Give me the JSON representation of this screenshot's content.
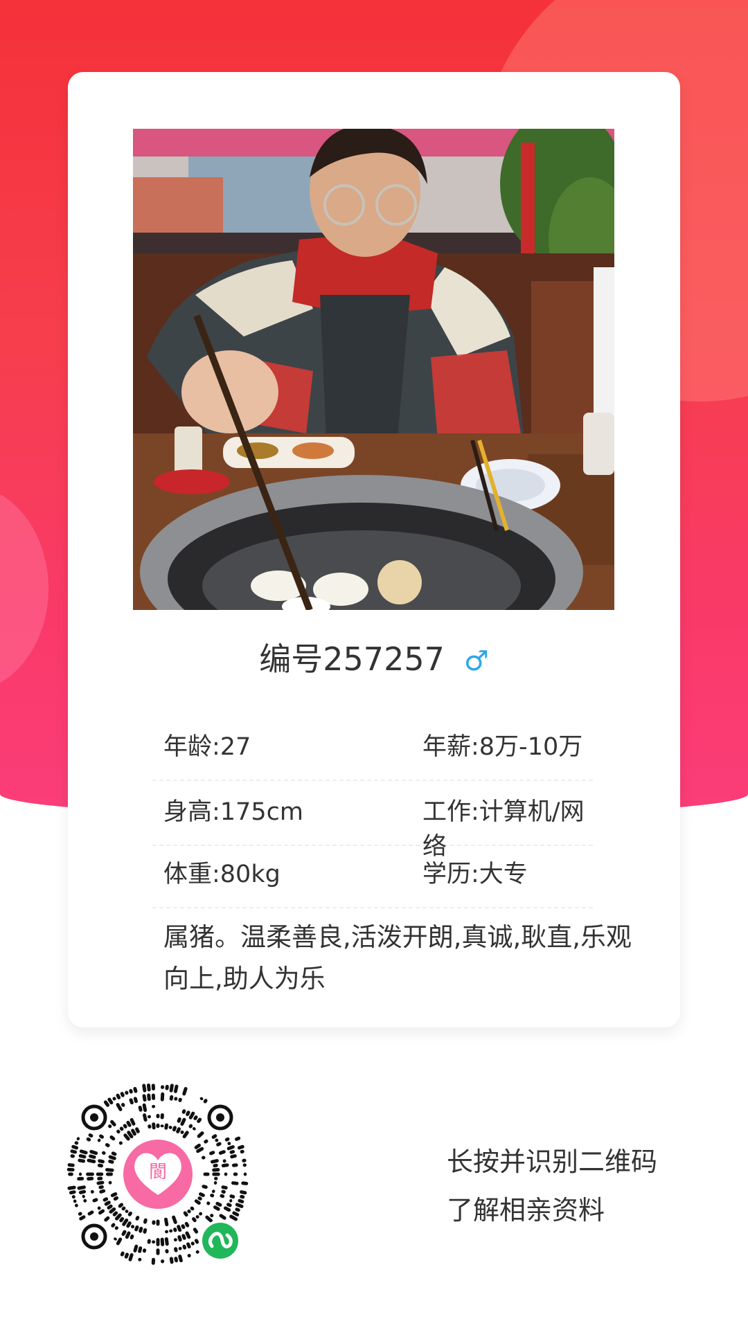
{
  "colors": {
    "primary": "#f5313a",
    "secondary": "#fb3d79",
    "gender": "#2aa7ee",
    "text": "#333333"
  },
  "profile": {
    "title": "编号257257",
    "gender_icon": "male-icon",
    "gender_symbol": "♂",
    "info": [
      {
        "left": "年龄:27",
        "right": "年薪:8万-10万"
      },
      {
        "left": "身高:175cm",
        "right": "工作:计算机/网络"
      },
      {
        "left": "体重:80kg",
        "right": "学历:大专"
      }
    ],
    "description": "属猪。温柔善良,活泼开朗,真诚,耿直,乐观向上,助人为乐"
  },
  "qr": {
    "logo_icon": "heart-logo-icon",
    "badge_icon": "mini-program-icon",
    "hint_line1": "长按并识别二维码",
    "hint_line2": "了解相亲资料"
  }
}
